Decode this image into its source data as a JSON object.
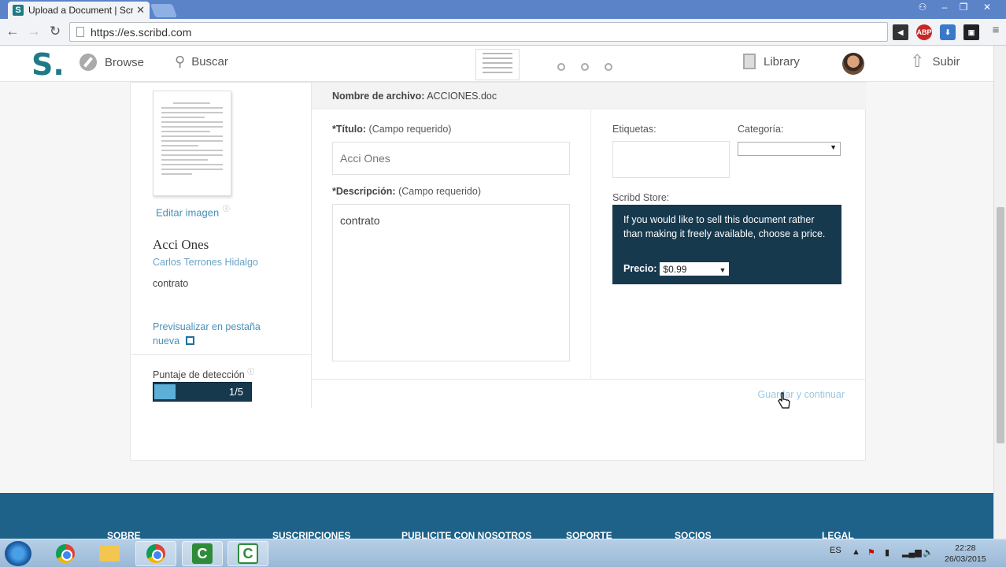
{
  "browser": {
    "tab_title": "Upload a Document | Scri",
    "favicon_letter": "S",
    "url": "https://es.scribd.com",
    "ext_abp": "ABP"
  },
  "header": {
    "logo": "S.",
    "browse": "Browse",
    "search": "Buscar",
    "library": "Library",
    "upload": "Subir"
  },
  "left": {
    "edit_image": "Editar imagen",
    "info_mark": "ⓘ",
    "title": "Acci Ones",
    "author": "Carlos Terrones Hidalgo",
    "description": "contrato",
    "preview": "Previsualizar en pestaña nueva",
    "score_label": "Puntaje de detección",
    "score_value": "1/5",
    "score_fraction": 0.2
  },
  "form": {
    "filename_label": "Nombre de archivo:",
    "filename": "ACCIONES.doc",
    "title_label": "*Título:",
    "title_hint": "(Campo requerido)",
    "title_placeholder": "Acci Ones",
    "desc_label": "*Descripción:",
    "desc_hint": "(Campo requerido)",
    "desc_value": "contrato",
    "tags_label": "Etiquetas:",
    "category_label": "Categoría:",
    "store_label": "Scribd Store:",
    "store_text": "If you would like to sell this document rather than making it freely available, choose a price.",
    "price_label": "Precio:",
    "price_value": "$0.99",
    "save_button": "Guardar y continuar"
  },
  "footer": {
    "items": [
      "SOBRE",
      "SUSCRIPCIONES",
      "PUBLICITE CON NOSOTROS",
      "SOPORTE",
      "SOCIOS",
      "LEGAL"
    ]
  },
  "taskbar": {
    "lang": "ES",
    "time": "22:28",
    "date": "26/03/2015"
  }
}
